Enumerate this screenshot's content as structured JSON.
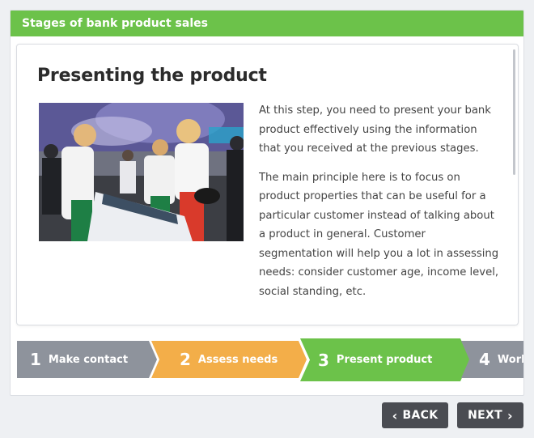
{
  "header": {
    "title": "Stages of bank product sales"
  },
  "slide": {
    "title": "Presenting the product",
    "paragraphs": [
      "At this step, you need to present your bank product effectively using the information that you received at the previous stages.",
      "The main principle here is to focus on product properties that can be useful for a particular customer instead of talking about a product in general. Customer segmentation will help you a lot in assessing needs: consider customer  age, income level, social standing, etc."
    ]
  },
  "steps": [
    {
      "num": "1",
      "label": "Make contact",
      "state": "done",
      "color": "#8e939c"
    },
    {
      "num": "2",
      "label": "Assess needs",
      "state": "done",
      "color": "#f3ae49"
    },
    {
      "num": "3",
      "label": "Present product",
      "state": "active",
      "color": "#6cc24a"
    },
    {
      "num": "4",
      "label": "Work",
      "state": "upcoming",
      "color": "#8e939c"
    }
  ],
  "nav": {
    "back_label": "BACK",
    "next_label": "NEXT",
    "back_icon": "chevron-left-icon",
    "next_icon": "chevron-right-icon"
  },
  "colors": {
    "accent": "#6cc24a",
    "button": "#4a4c52"
  }
}
